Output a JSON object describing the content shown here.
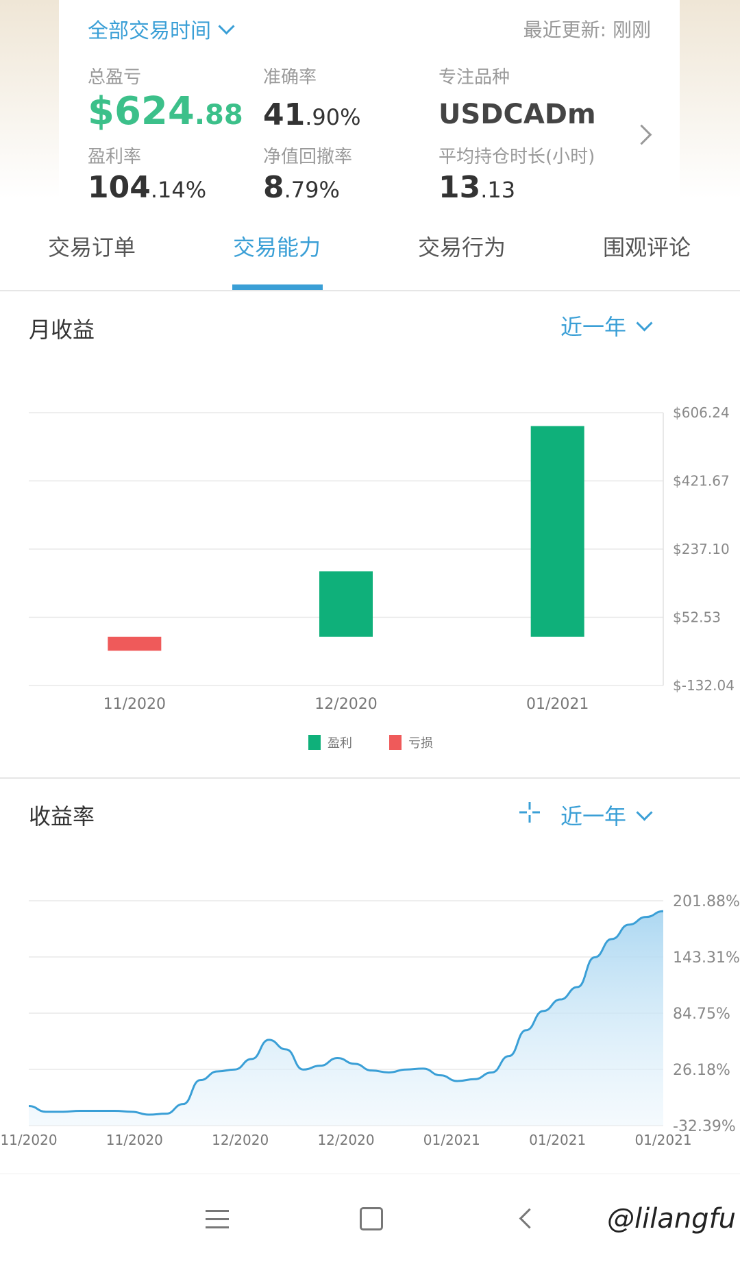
{
  "summary": {
    "time_filter": "全部交易时间",
    "updated": "最近更新: 刚刚",
    "total_pl_label": "总盈亏",
    "total_pl_main": "$624",
    "total_pl_dec": ".88",
    "accuracy_label": "准确率",
    "accuracy_main": "41",
    "accuracy_dec": ".90%",
    "symbol_label": "专注品种",
    "symbol_value": "USDCADm",
    "profit_rate_label": "盈利率",
    "profit_rate_main": "104",
    "profit_rate_dec": ".14%",
    "drawdown_label": "净值回撤率",
    "drawdown_main": "8",
    "drawdown_dec": ".79%",
    "hold_label": "平均持仓时长(小时)",
    "hold_main": "13",
    "hold_dec": ".13"
  },
  "tabs": [
    "交易订单",
    "交易能力",
    "交易行为",
    "围观评论"
  ],
  "monthly": {
    "title": "月收益",
    "range": "近一年"
  },
  "returns": {
    "title": "收益率",
    "range": "近一年"
  },
  "chart_data": [
    {
      "type": "bar",
      "categories": [
        "11/2020",
        "12/2020",
        "01/2021"
      ],
      "values": [
        -38,
        177,
        570
      ],
      "colors": [
        "#ef5a5a",
        "#0fb07a",
        "#0fb07a"
      ],
      "ylim": [
        -132.04,
        606.24
      ],
      "ytick_labels": [
        "$606.24",
        "$421.67",
        "$237.10",
        "$52.53",
        "$-132.04"
      ],
      "ytick_values": [
        606.24,
        421.67,
        237.1,
        52.53,
        -132.04
      ],
      "legend": [
        {
          "label": "盈利",
          "color": "#0fb07a"
        },
        {
          "label": "亏损",
          "color": "#ef5a5a"
        }
      ],
      "grid": true
    },
    {
      "type": "area",
      "x_labels": [
        "11/2020",
        "11/2020",
        "12/2020",
        "12/2020",
        "01/2021",
        "01/2021",
        "01/2021"
      ],
      "values": [
        -12,
        -18,
        -18,
        -17,
        -17,
        -17,
        -18,
        -21,
        -20,
        -10,
        15,
        24,
        26,
        37,
        57,
        47,
        26,
        30,
        38,
        32,
        25,
        23,
        26,
        27,
        20,
        14,
        16,
        23,
        40,
        67,
        87,
        99,
        112,
        143,
        162,
        177,
        185,
        191
      ],
      "color": "#3a9fd6",
      "ylim": [
        -32.39,
        201.88
      ],
      "ytick_labels": [
        "201.88%",
        "143.31%",
        "84.75%",
        "26.18%",
        "-32.39%"
      ],
      "ytick_values": [
        201.88,
        143.31,
        84.75,
        26.18,
        -32.39
      ],
      "grid": true
    }
  ]
}
